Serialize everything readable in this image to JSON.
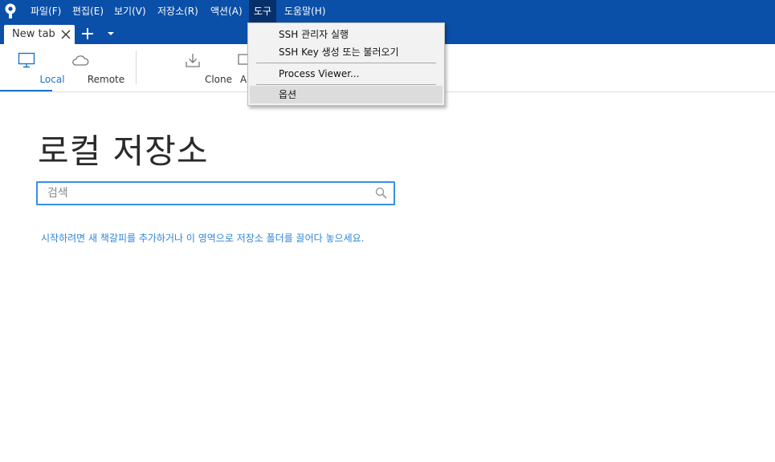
{
  "menubar": {
    "items": [
      "파일(F)",
      "편집(E)",
      "보기(V)",
      "저장소(R)",
      "액션(A)",
      "도구",
      "도움말(H)"
    ]
  },
  "tabs": {
    "active_label": "New tab"
  },
  "toolbar": {
    "local": "Local",
    "remote": "Remote",
    "clone": "Clone",
    "add_partial": "A"
  },
  "main": {
    "title": "로컬 저장소",
    "search_placeholder": "검색",
    "hint": "시작하려면 새 책갈피를 추가하거나 이 영역으로 저장소 폴더를 끌어다 놓으세요."
  },
  "tools_menu": {
    "items": [
      "SSH 관리자 실행",
      "SSH Key 생성 또는 불러오기",
      "Process Viewer...",
      "옵션"
    ]
  },
  "colors": {
    "accent": "#0a4fa8",
    "link": "#2f86d8"
  }
}
